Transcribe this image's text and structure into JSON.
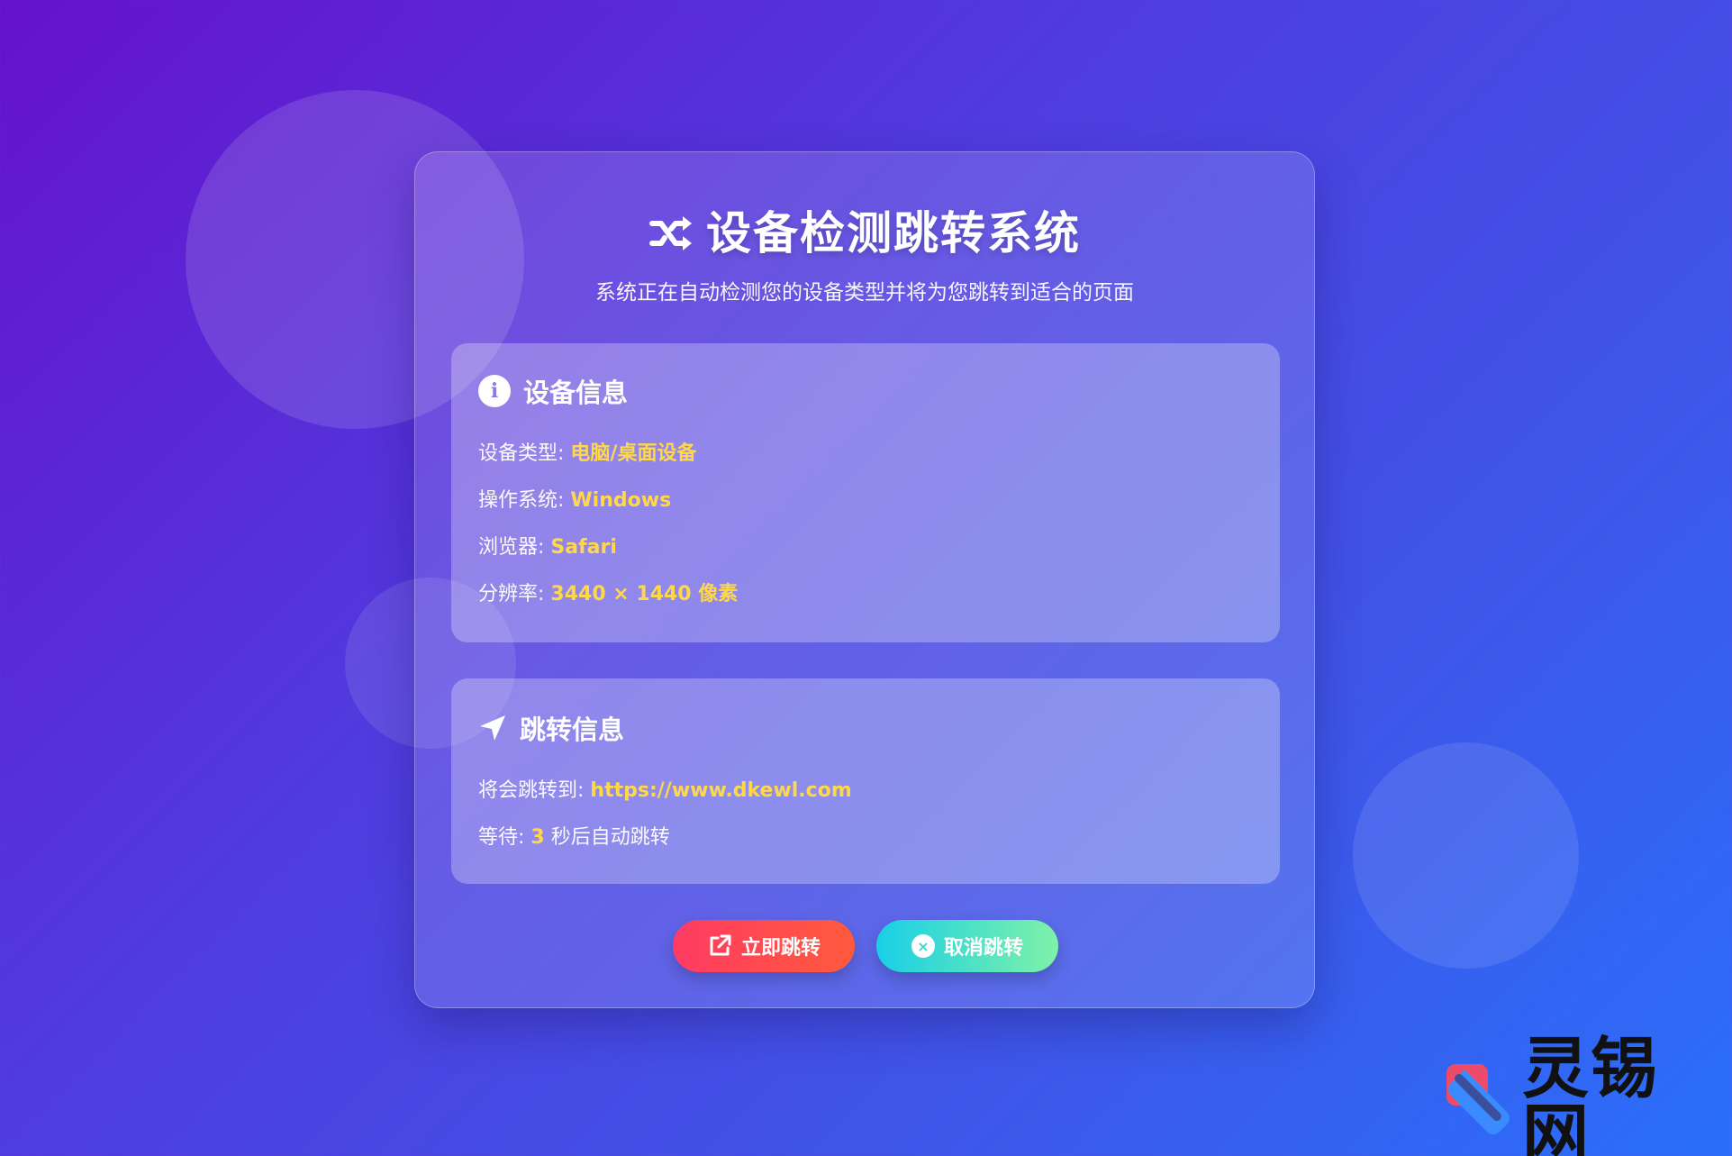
{
  "header": {
    "title": "设备检测跳转系统",
    "subtitle": "系统正在自动检测您的设备类型并将为您跳转到适合的页面"
  },
  "device_panel": {
    "heading": "设备信息",
    "icon": "info-circle-icon",
    "rows": [
      {
        "label": "设备类型: ",
        "value": "电脑/桌面设备"
      },
      {
        "label": "操作系统: ",
        "value": "Windows"
      },
      {
        "label": "浏览器: ",
        "value": "Safari"
      },
      {
        "label": "分辨率: ",
        "value": "3440 × 1440 像素"
      }
    ]
  },
  "redirect_panel": {
    "heading": "跳转信息",
    "icon": "location-arrow-icon",
    "target_label": "将会跳转到: ",
    "target_url": "https://www.dkewl.com",
    "wait_label": "等待: ",
    "wait_seconds": "3",
    "wait_suffix": " 秒后自动跳转"
  },
  "buttons": {
    "go_label": "立即跳转",
    "cancel_label": "取消跳转"
  },
  "brand": {
    "name": "灵锡网"
  },
  "colors": {
    "highlight": "#ffd84a",
    "go_button": "#ff3b63",
    "cancel_button": "#19cfe6"
  }
}
